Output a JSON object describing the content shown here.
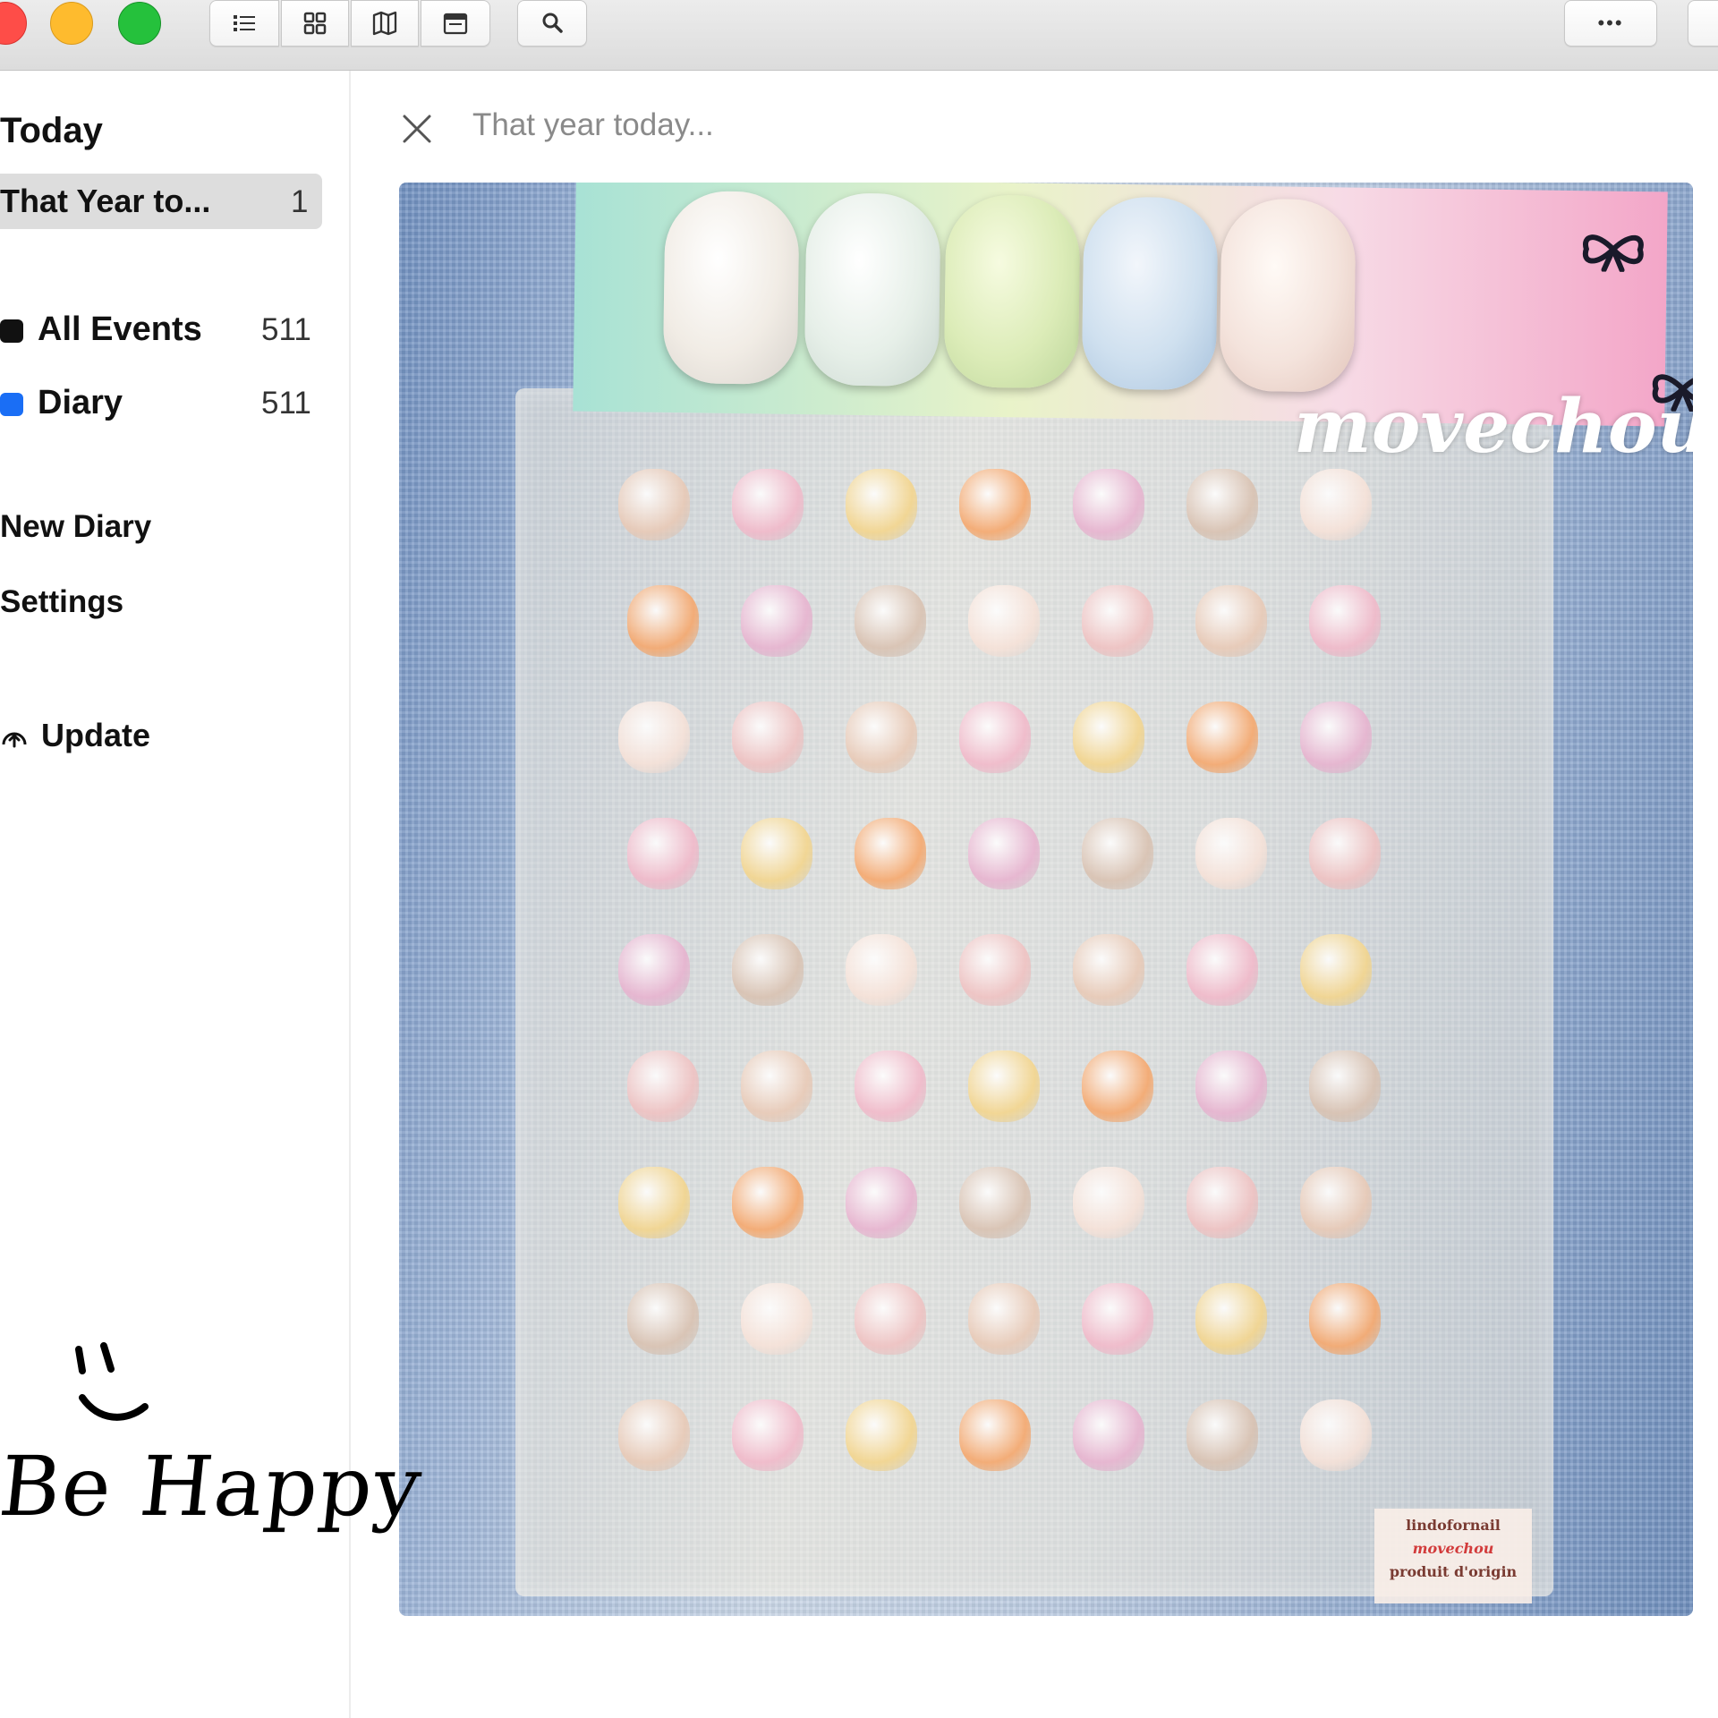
{
  "toolbar": {
    "buttons": [
      "list-view",
      "grid-view",
      "map-view",
      "calendar-view",
      "search",
      "more",
      "sidebar-toggle"
    ],
    "more_label": "•••"
  },
  "sidebar": {
    "today_heading": "Today",
    "selected_item": {
      "label": "That Year to...",
      "count": "1"
    },
    "calendars": [
      {
        "label": "All Events",
        "count": "511",
        "color": "#111111"
      },
      {
        "label": "Diary",
        "count": "511",
        "color": "#1a6ef5"
      }
    ],
    "actions": [
      "New Diary",
      "Settings"
    ],
    "update_label": "Update"
  },
  "main": {
    "search_placeholder": "That year today...",
    "photo": {
      "brand_text": "movechou",
      "tag_lines": [
        "lindofornail",
        "movechou",
        "produit d'origin"
      ]
    }
  },
  "handwriting": {
    "text": "Be Happy"
  }
}
